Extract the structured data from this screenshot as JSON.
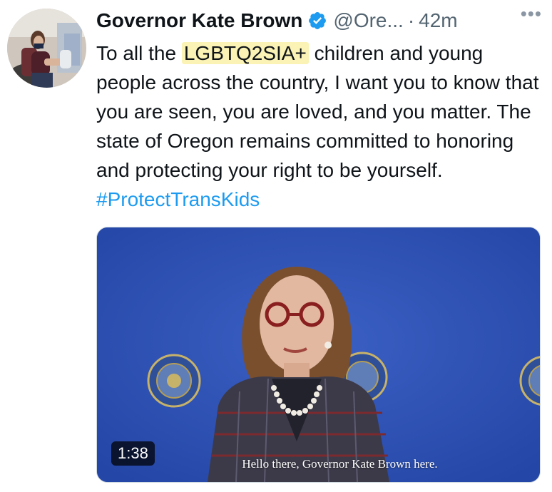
{
  "tweet": {
    "display_name": "Governor Kate Brown",
    "handle": "@Ore...",
    "separator": "·",
    "timestamp": "42m",
    "more_label": "•••",
    "text_before": "To all the ",
    "highlighted_term": "LGBTQ2SIA+",
    "text_after": " children and young people across the country, I want you to know that you are seen, you are loved, and you matter. The state of Oregon remains committed to honoring and protecting your right to be yourself. ",
    "hashtag": "#ProtectTransKids",
    "icons": {
      "verified": "verified-badge-icon",
      "more": "more-options-icon"
    },
    "colors": {
      "hashtag": "#1d9bf0",
      "highlight": "#fbf3b5",
      "verified": "#1d9bf0",
      "video_background": "#2d51b6"
    }
  },
  "video": {
    "duration": "1:38",
    "caption": "Hello there, Governor Kate Brown here."
  }
}
